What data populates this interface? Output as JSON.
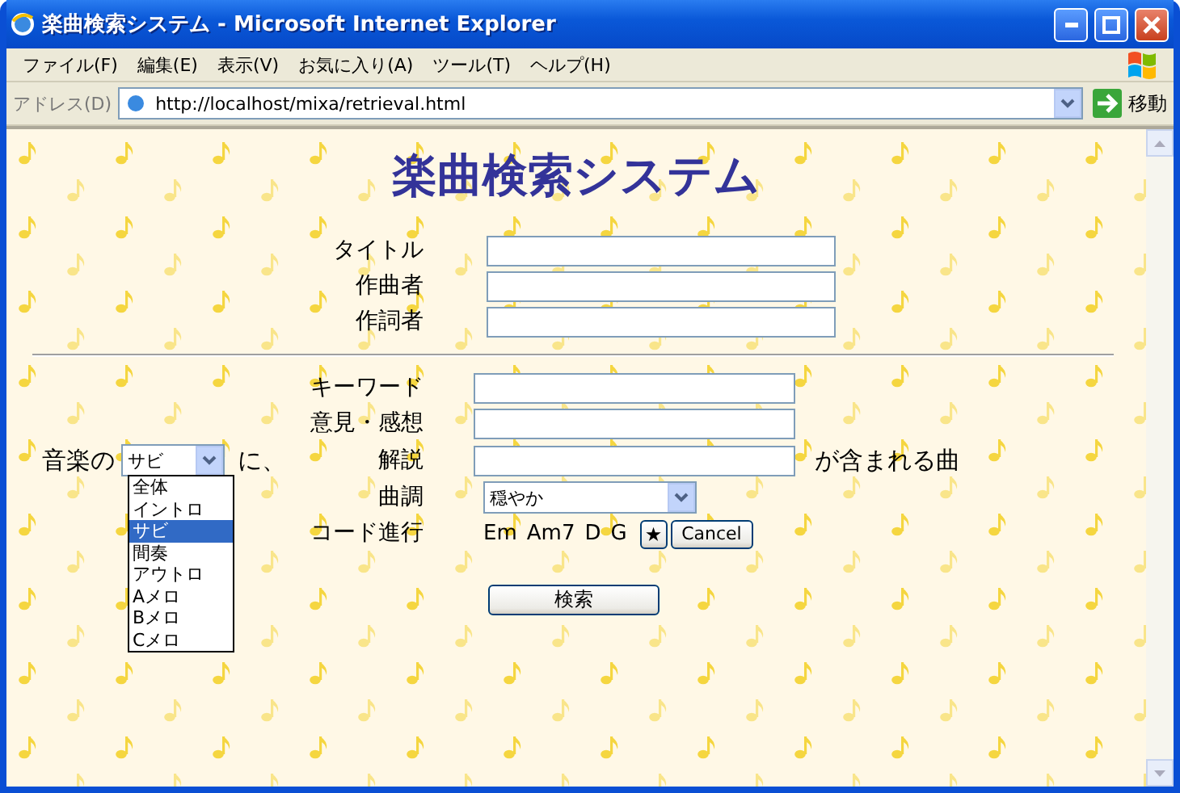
{
  "window": {
    "title": "楽曲検索システム - Microsoft Internet Explorer"
  },
  "menu": [
    "ファイル(F)",
    "編集(E)",
    "表示(V)",
    "お気に入り(A)",
    "ツール(T)",
    "ヘルプ(H)"
  ],
  "address_bar": {
    "label": "アドレス(D)",
    "url": "http://localhost/mixa/retrieval.html",
    "go": "移動"
  },
  "page": {
    "heading": "楽曲検索システム",
    "top_fields": [
      {
        "label": "タイトル"
      },
      {
        "label": "作曲者"
      },
      {
        "label": "作詞者"
      }
    ],
    "text_fields": [
      {
        "label": "キーワード"
      },
      {
        "label": "意見・感想"
      },
      {
        "label": "解説"
      }
    ],
    "part_select": {
      "prefix": "音楽の",
      "value": "サビ",
      "suffix": "に、",
      "expanded": true,
      "options": [
        {
          "label": "全体",
          "selected": false
        },
        {
          "label": "イントロ",
          "selected": false
        },
        {
          "label": "サビ",
          "selected": true
        },
        {
          "label": "間奏",
          "selected": false
        },
        {
          "label": "アウトロ",
          "selected": false
        },
        {
          "label": "Aメロ",
          "selected": false
        },
        {
          "label": "Bメロ",
          "selected": false
        },
        {
          "label": "Cメロ",
          "selected": false
        }
      ]
    },
    "contains_text": "が含まれる曲",
    "mood": {
      "label": "曲調",
      "value": "穏やか"
    },
    "chords": {
      "label": "コード進行",
      "items": [
        "Em",
        "Am7",
        "D",
        "G"
      ],
      "star_button": "★",
      "cancel_button": "Cancel"
    },
    "search_button": "検索"
  }
}
